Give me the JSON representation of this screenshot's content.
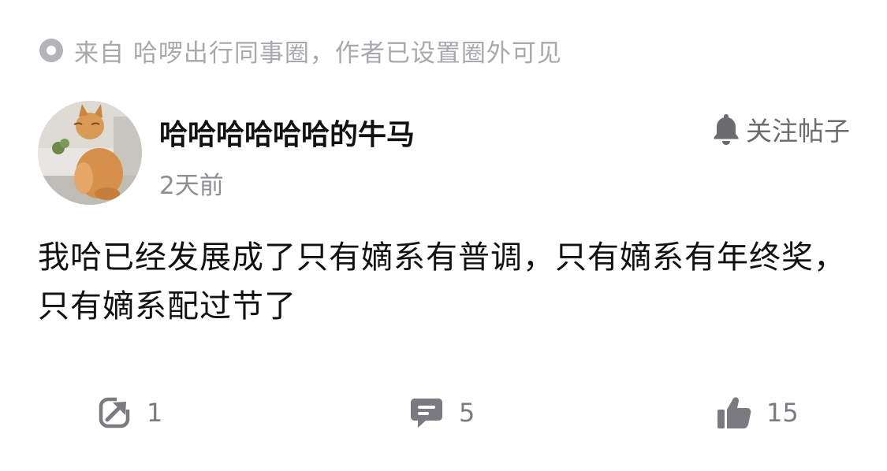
{
  "source": {
    "icon": "circle-dot-icon",
    "text": "来自 哈啰出行同事圈，作者已设置圈外可见"
  },
  "author": {
    "avatar": "cat-avatar",
    "name": "哈哈哈哈哈哈的牛马",
    "time": "2天前"
  },
  "follow": {
    "icon": "bell-icon",
    "label": "关注帖子"
  },
  "post": {
    "text": "我哈已经发展成了只有嫡系有普调，只有嫡系有年终奖，只有嫡系配过节了"
  },
  "actions": {
    "repost": {
      "icon": "share-arrow-icon",
      "count": "1"
    },
    "comment": {
      "icon": "comment-icon",
      "count": "5"
    },
    "like": {
      "icon": "thumbs-up-icon",
      "count": "15"
    }
  },
  "colors": {
    "muted_text": "#a9a9ad",
    "secondary_text": "#8e8e93",
    "icon_gray": "#7a7a80",
    "primary_text": "#111111"
  }
}
